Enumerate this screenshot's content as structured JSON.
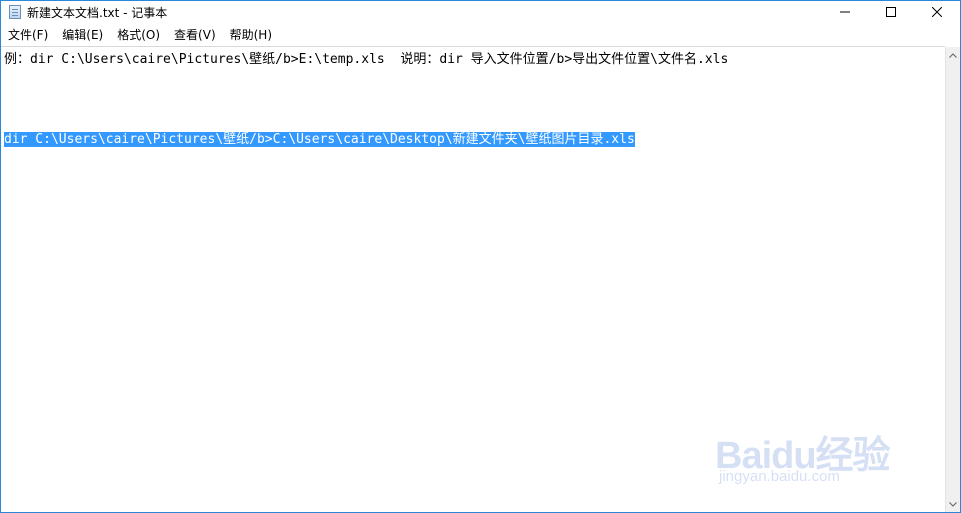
{
  "window": {
    "title": "新建文本文档.txt - 记事本",
    "icon": "notepad-icon",
    "controls": [
      "minimize-icon",
      "maximize-icon",
      "close-icon"
    ]
  },
  "menu": {
    "file": "文件(F)",
    "edit": "编辑(E)",
    "format": "格式(O)",
    "view": "查看(V)",
    "help": "帮助(H)"
  },
  "editor": {
    "line1": "例：dir C:\\Users\\caire\\Pictures\\壁纸/b>E:\\temp.xls  说明：dir 导入文件位置/b>导出文件位置\\文件名.xls",
    "line2": "dir C:\\Users\\caire\\Pictures\\壁纸/b>C:\\Users\\caire\\Desktop\\新建文件夹\\壁纸图片目录.xls",
    "selection_color": "#3399ff"
  },
  "watermark": {
    "brand": "Baidu经验",
    "url": "jingyan.baidu.com"
  }
}
